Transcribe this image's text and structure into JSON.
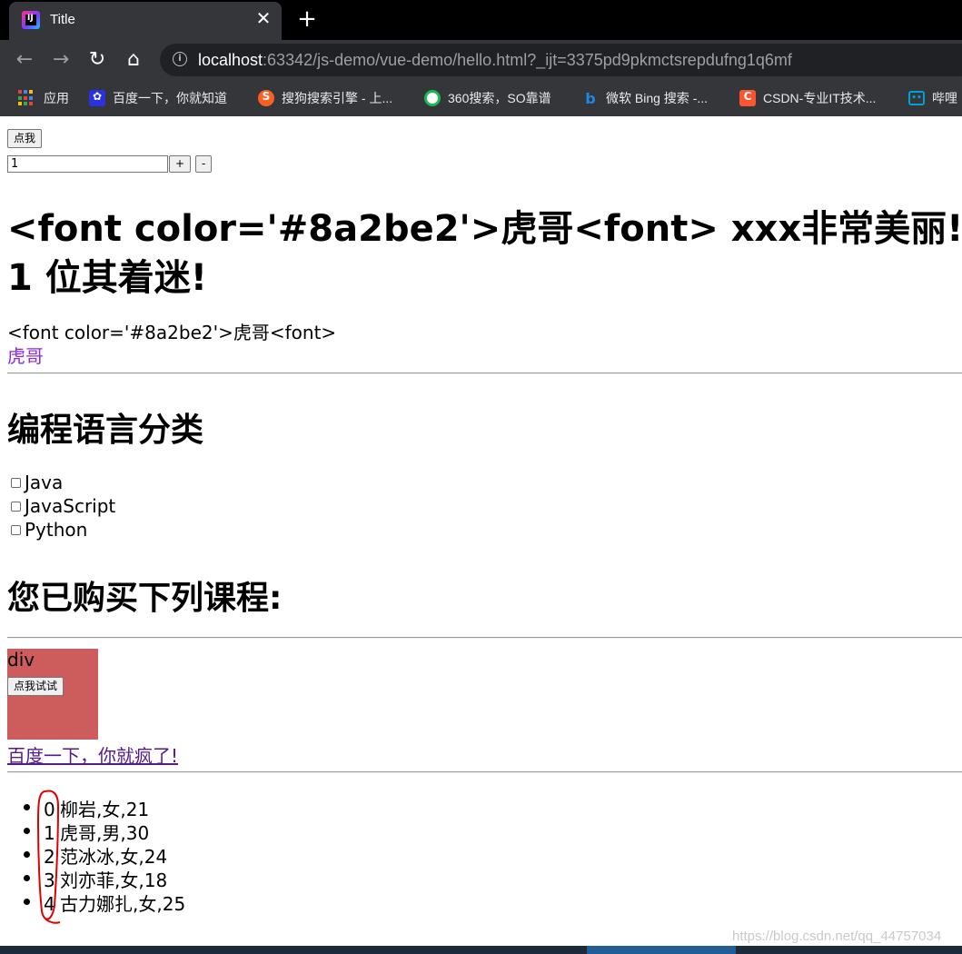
{
  "browser": {
    "tab": {
      "title": "Title",
      "close_glyph": "✕"
    },
    "new_tab_glyph": "+",
    "nav": {
      "back_glyph": "←",
      "forward_glyph": "→",
      "reload_glyph": "↻",
      "home_glyph": "⌂"
    },
    "address": {
      "host": "localhost",
      "rest": ":63342/js-demo/vue-demo/hello.html?_ijt=3375pd9pkmctsrepdufng1q6mf"
    },
    "bookmarks": [
      {
        "label": "应用",
        "icon": "apps-grid-icon",
        "color": ""
      },
      {
        "label": "百度一下，你就知道",
        "icon": "baidu-paw-icon",
        "color": "#2932e1"
      },
      {
        "label": "搜狗搜索引擎 - 上...",
        "icon": "sogou-icon",
        "color": "#fb6022"
      },
      {
        "label": "360搜索，SO靠谱",
        "icon": "so360-icon",
        "color": "#19b955"
      },
      {
        "label": "微软 Bing 搜索 -...",
        "icon": "bing-icon",
        "color": "#1e88e5"
      },
      {
        "label": "CSDN-专业IT技术...",
        "icon": "csdn-icon",
        "color": "#fc5531"
      },
      {
        "label": "哔哩",
        "icon": "bilibili-icon",
        "color": "#00a1d6"
      }
    ]
  },
  "page": {
    "click_button": "点我",
    "counter": {
      "value": "1",
      "plus": "+",
      "minus": "-"
    },
    "headline_line1": "<font color='#8a2be2'>虎哥<font> xxx非常美丽!",
    "headline_line2": "1 位其着迷!",
    "raw_html_text": "<font color='#8a2be2'>虎哥<font>",
    "rendered_html_text": "虎哥",
    "rendered_color": "#8a2be2",
    "languages_title": "编程语言分类",
    "languages": [
      "Java",
      "JavaScript",
      "Python"
    ],
    "courses_title": "您已购买下列课程:",
    "box": {
      "label": "div",
      "button": "点我试试",
      "color": "#cd5c5c"
    },
    "link_text": "百度一下，你就疯了!",
    "people": [
      {
        "index": "0",
        "text": "柳岩,女,21"
      },
      {
        "index": "1",
        "text": "虎哥,男,30"
      },
      {
        "index": "2",
        "text": "范冰冰,女,24"
      },
      {
        "index": "3",
        "text": "刘亦菲,女,18"
      },
      {
        "index": "4",
        "text": "古力娜扎,女,25"
      }
    ],
    "watermark": "https://blog.csdn.net/qq_44757034"
  }
}
